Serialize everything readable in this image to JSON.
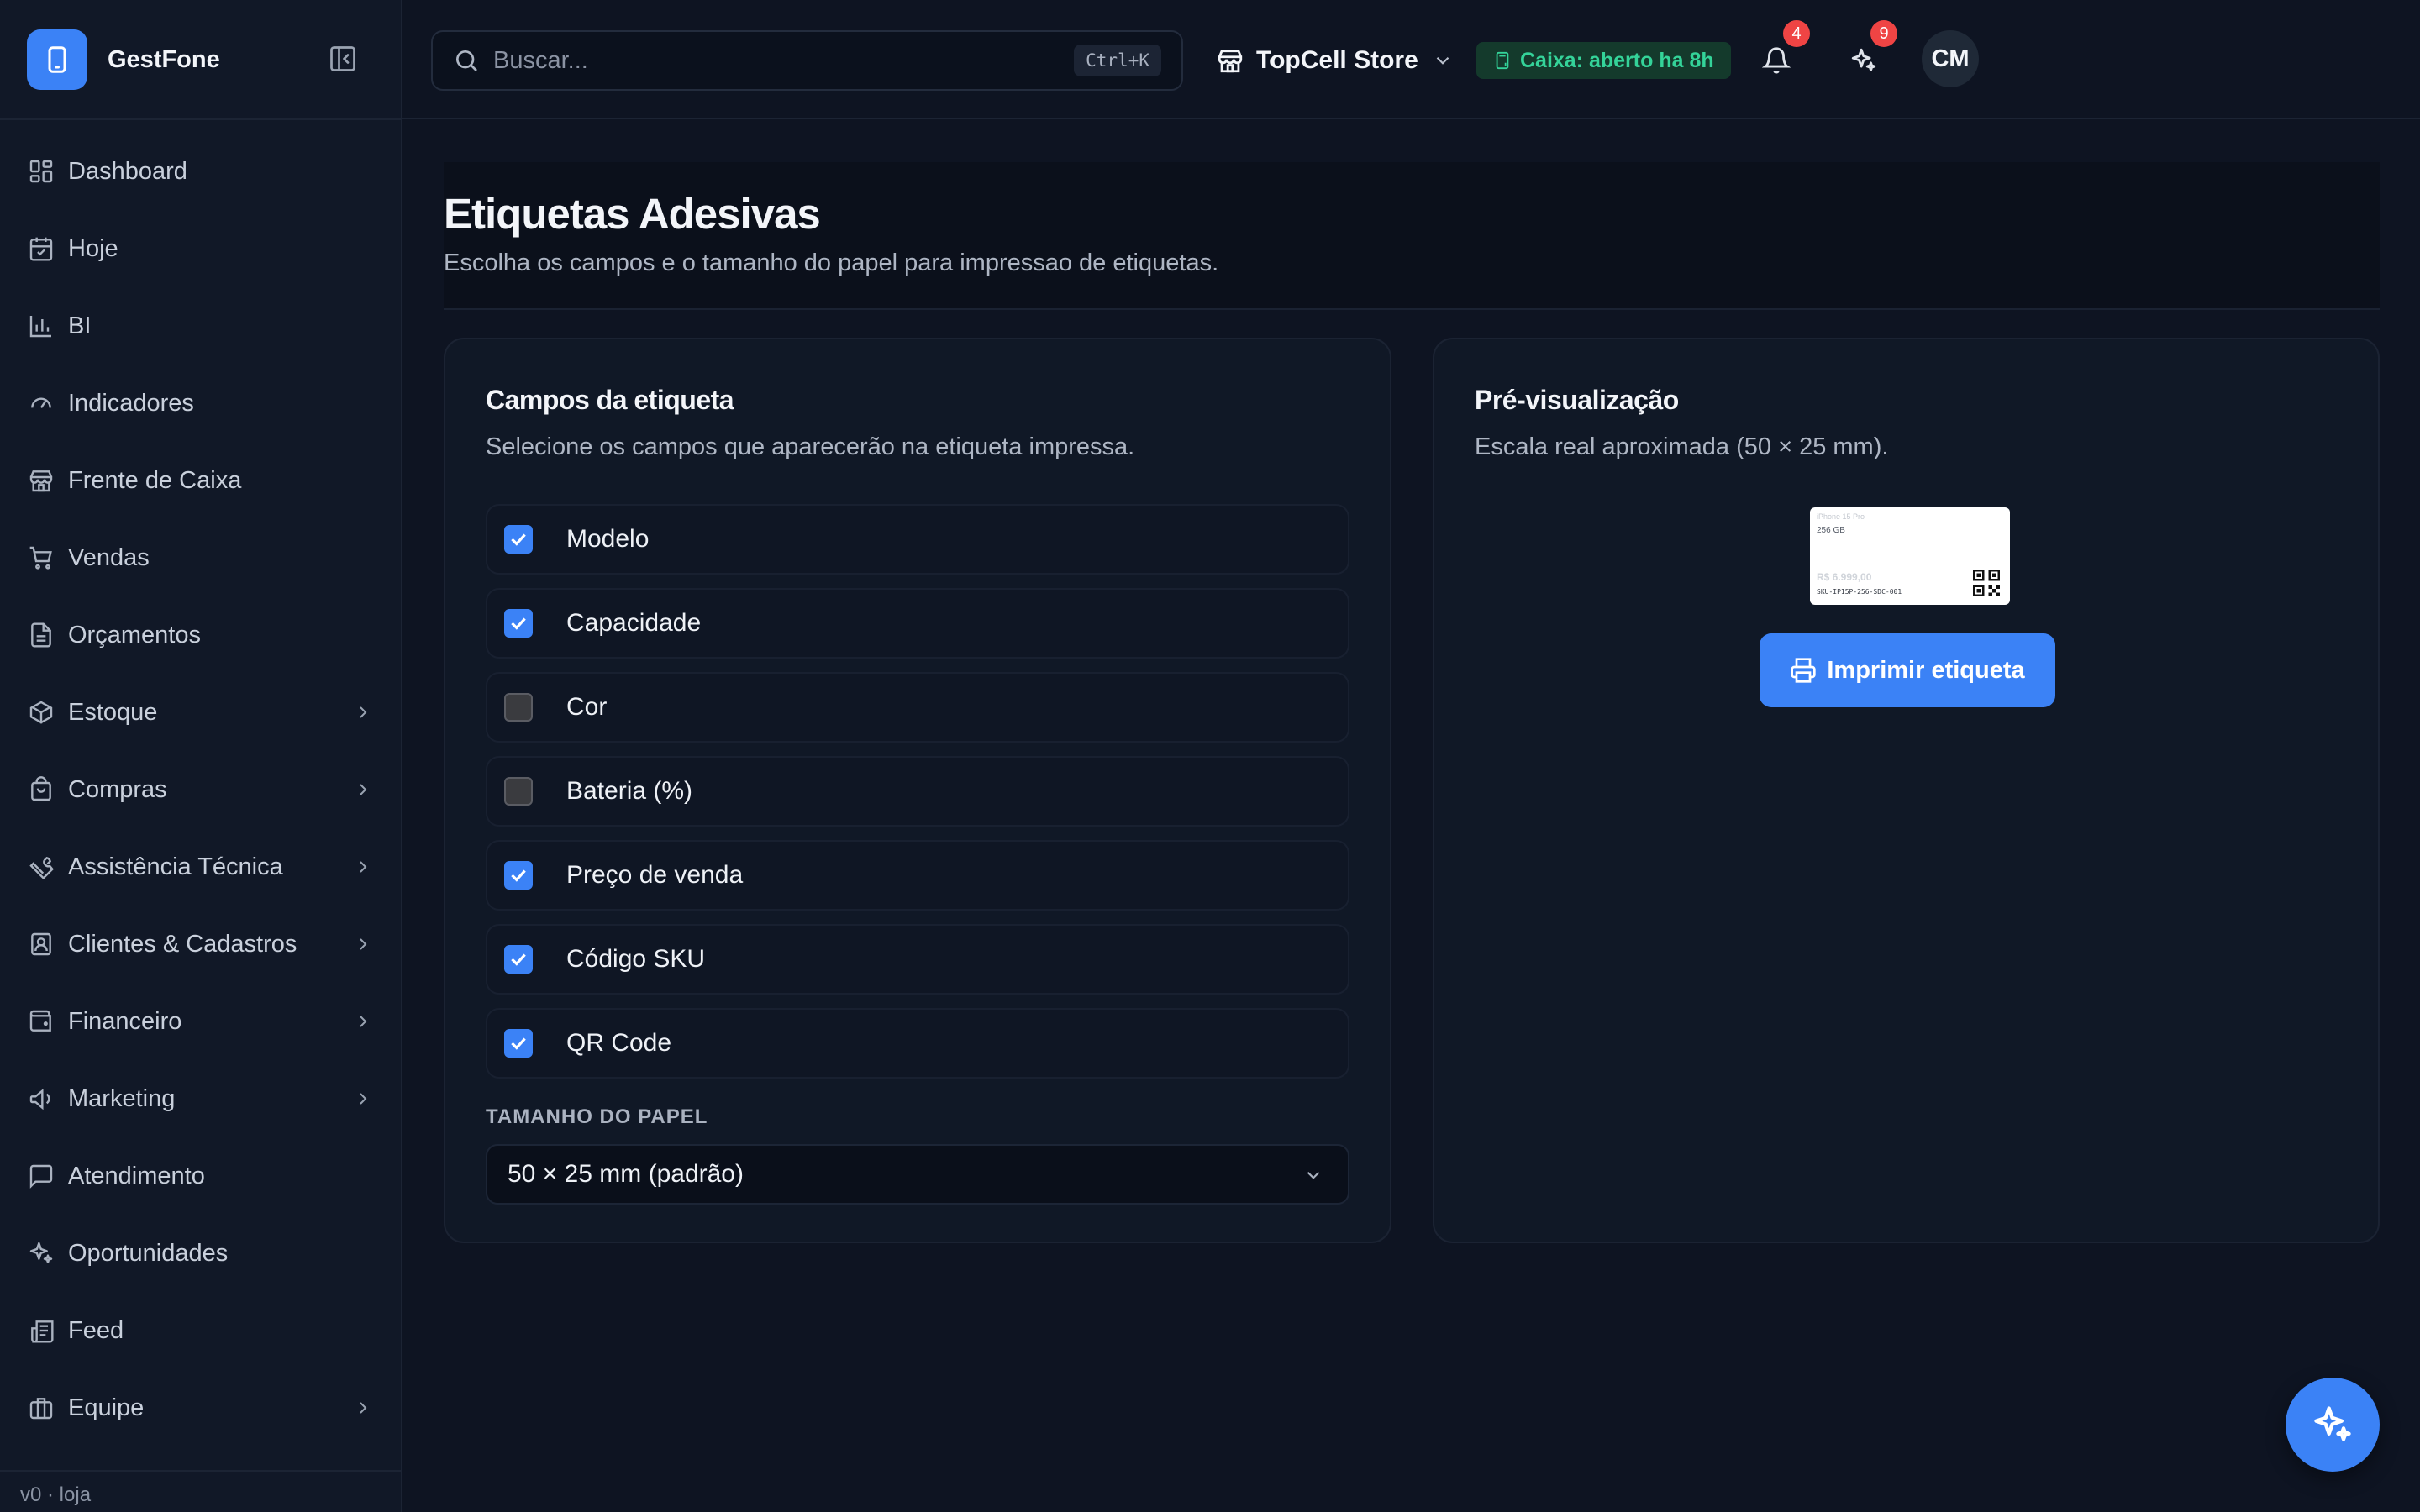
{
  "app": {
    "name": "GestFone",
    "version_label": "v0 · loja"
  },
  "colors": {
    "accent": "#3b82f6",
    "badge": "#ef4444",
    "caixa_text": "#34d399",
    "caixa_bg": "#143a2c"
  },
  "sidebar": {
    "items": [
      {
        "label": "Dashboard",
        "icon": "dashboard-icon",
        "expandable": false
      },
      {
        "label": "Hoje",
        "icon": "calendar-icon",
        "expandable": false
      },
      {
        "label": "BI",
        "icon": "bar-chart-icon",
        "expandable": false
      },
      {
        "label": "Indicadores",
        "icon": "gauge-icon",
        "expandable": false
      },
      {
        "label": "Frente de Caixa",
        "icon": "store-icon",
        "expandable": false
      },
      {
        "label": "Vendas",
        "icon": "cart-icon",
        "expandable": false
      },
      {
        "label": "Orçamentos",
        "icon": "document-icon",
        "expandable": false
      },
      {
        "label": "Estoque",
        "icon": "package-icon",
        "expandable": true
      },
      {
        "label": "Compras",
        "icon": "shopping-bag-icon",
        "expandable": true
      },
      {
        "label": "Assistência Técnica",
        "icon": "wrench-icon",
        "expandable": true
      },
      {
        "label": "Clientes & Cadastros",
        "icon": "contact-icon",
        "expandable": true
      },
      {
        "label": "Financeiro",
        "icon": "wallet-icon",
        "expandable": true
      },
      {
        "label": "Marketing",
        "icon": "megaphone-icon",
        "expandable": true
      },
      {
        "label": "Atendimento",
        "icon": "chat-icon",
        "expandable": false
      },
      {
        "label": "Oportunidades",
        "icon": "sparkles-icon",
        "expandable": false
      },
      {
        "label": "Feed",
        "icon": "newspaper-icon",
        "expandable": false
      },
      {
        "label": "Equipe",
        "icon": "briefcase-icon",
        "expandable": true
      }
    ]
  },
  "header": {
    "search": {
      "placeholder": "Buscar...",
      "shortcut": "Ctrl+K"
    },
    "store_name": "TopCell Store",
    "caixa_status": "Caixa: aberto ha 8h",
    "notifications_count": "4",
    "ai_count": "9",
    "avatar_initials": "CM"
  },
  "page": {
    "title": "Etiquetas Adesivas",
    "subtitle": "Escolha os campos e o tamanho do papel para impressao de etiquetas."
  },
  "fields_card": {
    "title": "Campos da etiqueta",
    "subtitle": "Selecione os campos que aparecerão na etiqueta impressa.",
    "fields": [
      {
        "label": "Modelo",
        "checked": true
      },
      {
        "label": "Capacidade",
        "checked": true
      },
      {
        "label": "Cor",
        "checked": false
      },
      {
        "label": "Bateria (%)",
        "checked": false
      },
      {
        "label": "Preço de venda",
        "checked": true
      },
      {
        "label": "Código SKU",
        "checked": true
      },
      {
        "label": "QR Code",
        "checked": true
      }
    ],
    "paper_label": "TAMANHO DO PAPEL",
    "paper_value": "50 × 25 mm (padrão)"
  },
  "preview_card": {
    "title": "Pré-visualização",
    "subtitle": "Escala real aproximada (50 × 25 mm).",
    "label": {
      "model": "iPhone 15 Pro",
      "capacity": "256 GB",
      "price": "R$ 6.999,00",
      "sku": "SKU-IP15P-256-SDC-001"
    },
    "print_button": "Imprimir etiqueta"
  }
}
